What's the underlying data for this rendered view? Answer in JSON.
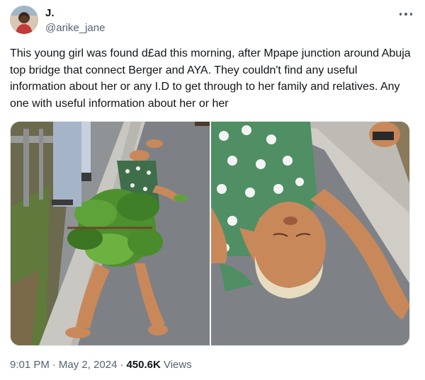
{
  "author": {
    "display_name": "J.",
    "handle": "@arike_jane"
  },
  "tweet": {
    "text": "This young girl was found d£ad this morning, after Mpape junction around Abuja top bridge that connect Berger and AYA. They couldn't find any useful information about her or any I.D to get through to her family and relatives. Any one with useful information about her or her"
  },
  "meta": {
    "time": "9:01 PM",
    "separator": "·",
    "date": "May 2, 2024",
    "views_count": "450.6K",
    "views_label": "Views"
  },
  "icons": {
    "more": "more-horizontal-icon"
  }
}
